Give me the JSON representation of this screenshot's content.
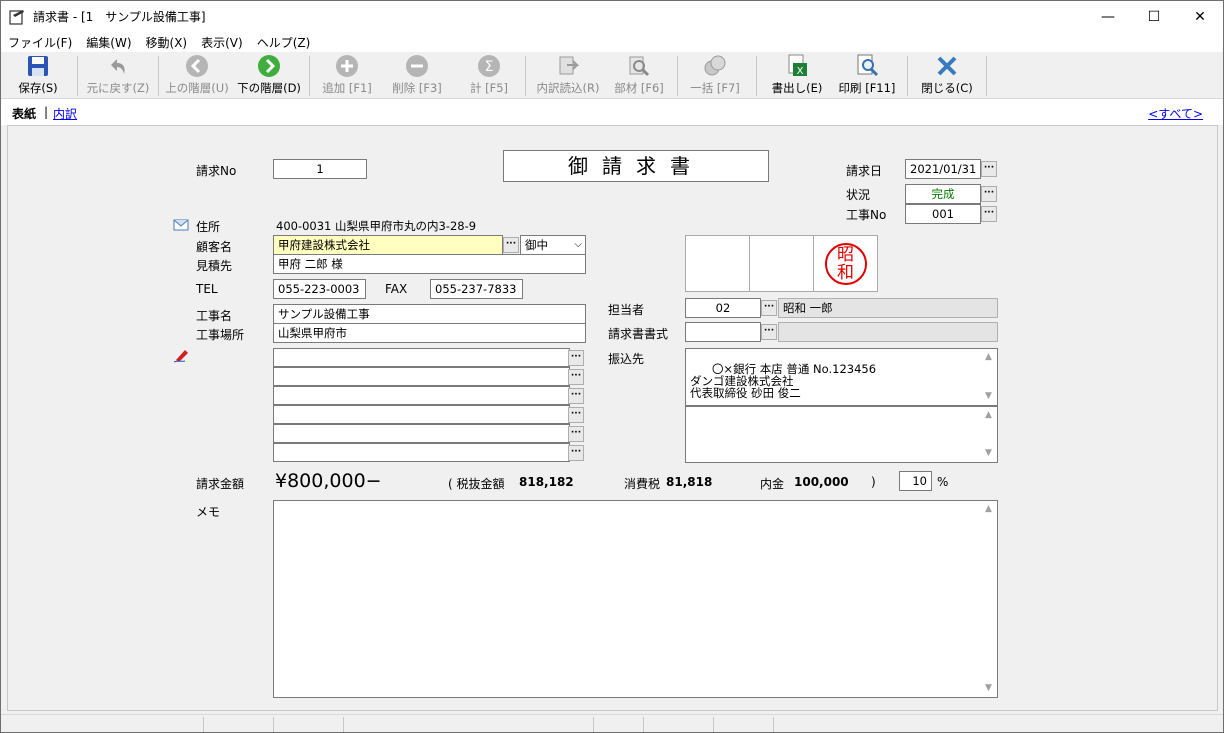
{
  "window": {
    "title": "請求書 - [1　サンプル設備工事]",
    "minimize": "—",
    "maximize": "☐",
    "close": "✕"
  },
  "menu": [
    "ファイル(F)",
    "編集(W)",
    "移動(X)",
    "表示(V)",
    "ヘルプ(Z)"
  ],
  "toolbar": {
    "save": "保存(S)",
    "undo": "元に戻す(Z)",
    "up": "上の階層(U)",
    "down": "下の階層(D)",
    "add": "追加 [F1]",
    "delete": "削除 [F3]",
    "sum": "計 [F5]",
    "import": "内訳読込(R)",
    "parts": "部材 [F6]",
    "bulk": "一括 [F7]",
    "export": "書出し(E)",
    "print": "印刷 [F11]",
    "close": "閉じる(C)"
  },
  "tabs": {
    "cover": "表紙",
    "separator": "|",
    "detail": "内訳",
    "all": "<すべて>"
  },
  "form": {
    "invoice_no_label": "請求No",
    "invoice_no": "1",
    "doc_title": "御請求書",
    "date_label": "請求日",
    "date": "2021/01/31",
    "status_label": "状況",
    "status": "完成",
    "work_no_label": "工事No",
    "work_no": "001",
    "address_label": "住所",
    "address": "400-0031 山梨県甲府市丸の内3-28-9",
    "customer_label": "顧客名",
    "customer": "甲府建設株式会社",
    "honorific": "御中",
    "estimate_to_label": "見積先",
    "estimate_to": "甲府 二郎 様",
    "tel_label": "TEL",
    "tel": "055-223-0003",
    "fax_label": "FAX",
    "fax": "055-237-7833",
    "work_name_label": "工事名",
    "work_name": "サンプル設備工事",
    "work_place_label": "工事場所",
    "work_place": "山梨県甲府市",
    "stamp_text_1": "昭",
    "stamp_text_2": "和",
    "staff_label": "担当者",
    "staff_code": "02",
    "staff_name": "昭和 一郎",
    "format_label": "請求書書式",
    "format_value": "",
    "bank_label": "振込先",
    "bank_text": "〇×銀行 本店 普通 No.123456\nダンゴ建設株式会社\n代表取締役 砂田 俊二",
    "amount_label": "請求金額",
    "amount": "¥800,000−",
    "excl_tax_label": "( 税抜金額",
    "excl_tax": "818,182",
    "tax_label": "消費税",
    "tax": "81,818",
    "included_label": "内金",
    "included": "100,000",
    "close_paren": ")",
    "tax_rate": "10",
    "percent": "%",
    "memo_label": "メモ",
    "memo": ""
  },
  "colors": {
    "status_green": "#007a00",
    "customer_highlight": "#ffffc0",
    "stamp_red": "#e00000",
    "link_blue": "#0000ee"
  }
}
